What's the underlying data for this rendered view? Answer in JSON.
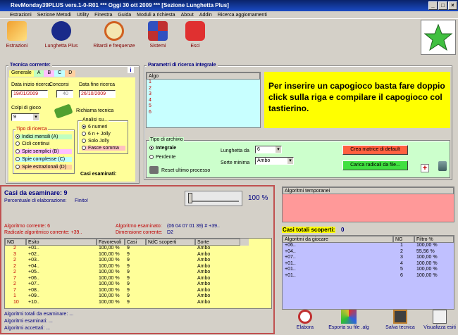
{
  "title": "RevMonday39PLUS vers.1-0-R01   ***  Oggi 30 ott 2009  ***   [Sezione Lunghetta Plus]",
  "menu": [
    "Estrazioni",
    "Sezione Metodi",
    "Utility",
    "Finestra",
    "Guida",
    "Moduli a richiesta",
    "About",
    "Addin",
    "Ricerca aggiornamenti"
  ],
  "toolbar": [
    "Estrazioni",
    "Lunghetta Plus",
    "Ritardi e frequenze",
    "Sistemi",
    "Esci"
  ],
  "tecnica": {
    "label": "Tecnica corrente:",
    "tabs": [
      "Generale",
      "A",
      "B",
      "C",
      "D"
    ],
    "data_inizio_label": "Data inizio ricerca",
    "data_inizio": "19/01/2009",
    "concorsi_label": "Concorsi",
    "concorsi": "40",
    "data_fine_label": "Data fine ricerca",
    "data_fine": "26/10/2009",
    "colpi_label": "Colpi di gioco",
    "colpi": "9",
    "richiama": "Richiama tecnica",
    "tipo_label": "Tipo di ricerca",
    "tipi": [
      "Indici mensili (A)",
      "Cicli continui",
      "Spie semplici (B)",
      "Spie complesse (C)",
      "Spie estrazionali (D)"
    ],
    "analisi_label": "Analisi su...",
    "analisi": [
      "6 numeri",
      "6 n + Jolly",
      "Solo Jolly",
      "Fasce somma"
    ],
    "casi_esaminati": "Casi esaminati:"
  },
  "parametri": {
    "label": "Parametri di ricerca integrale",
    "col": "Algo",
    "rows": [
      "1",
      "2",
      "3",
      "4",
      "5",
      "6"
    ],
    "info": "Per inserire un capogioco basta fare doppio click sulla riga e compilare il capogioco col tastierino."
  },
  "archivio": {
    "label": "Tipo di archivio",
    "opt1": "Integrale",
    "opt2": "Perdente",
    "reset": "Reset ultimo processo",
    "lunghetta_label": "Lunghetta da",
    "lunghetta": "6",
    "sorte_label": "Sorte minima",
    "sorte": "Ambo",
    "crea": "Crea matrice di default",
    "carica": "Carica radicali da file..."
  },
  "casi": {
    "title": "Casi da esaminare: 9",
    "perc_label": "Percentuale di elaborazione:",
    "perc": "Finito!",
    "pct": "100 %",
    "algo_corr": "Algoritmo corrente: 6",
    "algo_esam_label": "Algoritmo esaminato:",
    "algo_esam": "(06 04 07 01 39) # +39..",
    "radicale": "Radicale algoritmico corrente:   +39..",
    "dimensione_label": "Dimensione corrente:",
    "dimensione": "D2",
    "cols": [
      "NG",
      "Esito",
      "Favorevoli",
      "Casi",
      "NdC scoperti",
      "Sorte"
    ],
    "rows": [
      [
        "2",
        "+01..",
        "100,00 %",
        "9",
        "",
        "Ambo"
      ],
      [
        "3",
        "+02..",
        "100,00 %",
        "9",
        "",
        "Ambo"
      ],
      [
        "2",
        "+03..",
        "100,00 %",
        "9",
        "",
        "Ambo"
      ],
      [
        "2",
        "+04..",
        "100,00 %",
        "9",
        "",
        "Ambo"
      ],
      [
        "2",
        "+05..",
        "100,00 %",
        "9",
        "",
        "Ambo"
      ],
      [
        "7",
        "+06..",
        "100,00 %",
        "9",
        "",
        "Ambo"
      ],
      [
        "2",
        "+07..",
        "100,00 %",
        "9",
        "",
        "Ambo"
      ],
      [
        "7",
        "+08..",
        "100,00 %",
        "9",
        "",
        "Ambo"
      ],
      [
        "1",
        "+09..",
        "100,00 %",
        "9",
        "",
        "Ambo"
      ],
      [
        "10",
        "+10..",
        "100,00 %",
        "9",
        "",
        "Ambo"
      ]
    ],
    "foot": [
      "Algoritmi totali da esaminare:   ...",
      "Algoritmi esaminati:   ...",
      "Algoritmi accettati:   ..."
    ]
  },
  "temporanei": {
    "label": "Algoritmi temporanei"
  },
  "scoperti": {
    "label": "Casi totali scoperti:",
    "count": "0",
    "cols": [
      "Algoritmi da giocare",
      "NG",
      "Filtro %"
    ],
    "rows": [
      [
        "+06..",
        "1",
        "100,00 %"
      ],
      [
        "+04..",
        "2",
        "55,56 %"
      ],
      [
        "+07..",
        "3",
        "100,00 %"
      ],
      [
        "+01..",
        "4",
        "100,00 %"
      ],
      [
        "+01..",
        "5",
        "100,00 %"
      ],
      [
        "+01..",
        "6",
        "100,00 %"
      ]
    ]
  },
  "bottom": [
    "Elabora",
    "Esporta su file .alg",
    "Salva tecnica",
    "Visualizza esiti"
  ],
  "colors": {
    "yellow": "#ffff00",
    "pink": "#ff9999",
    "cyan": "#c8ffff",
    "lavender": "#c0c0ff",
    "green": "#ccffcc"
  }
}
